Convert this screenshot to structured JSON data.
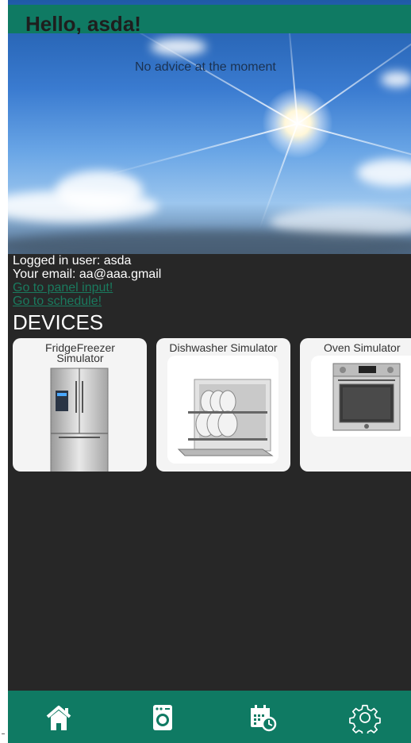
{
  "header": {
    "greeting": "Hello, asda!"
  },
  "advice": {
    "text": "No advice at the moment"
  },
  "user": {
    "logged_in": "Logged in user: asda",
    "email": "Your email: aa@aaa.gmail",
    "panel_link": "Go to panel input!",
    "schedule_link": "Go to schedule!"
  },
  "devices": {
    "heading": "DEVICES",
    "items": [
      {
        "name": "FridgeFreezer Simulator",
        "icon": "fridge-freezer-image"
      },
      {
        "name": "Dishwasher Simulator",
        "icon": "dishwasher-image"
      },
      {
        "name": "Oven Simulator",
        "icon": "oven-image"
      }
    ]
  },
  "nav": {
    "items": [
      {
        "name": "home",
        "icon": "home-icon"
      },
      {
        "name": "devices",
        "icon": "washing-machine-icon"
      },
      {
        "name": "schedule",
        "icon": "calendar-clock-icon"
      },
      {
        "name": "settings",
        "icon": "gear-icon"
      }
    ]
  },
  "colors": {
    "brand": "#0f7a63",
    "background": "#272727",
    "link": "#1a7a5e"
  }
}
